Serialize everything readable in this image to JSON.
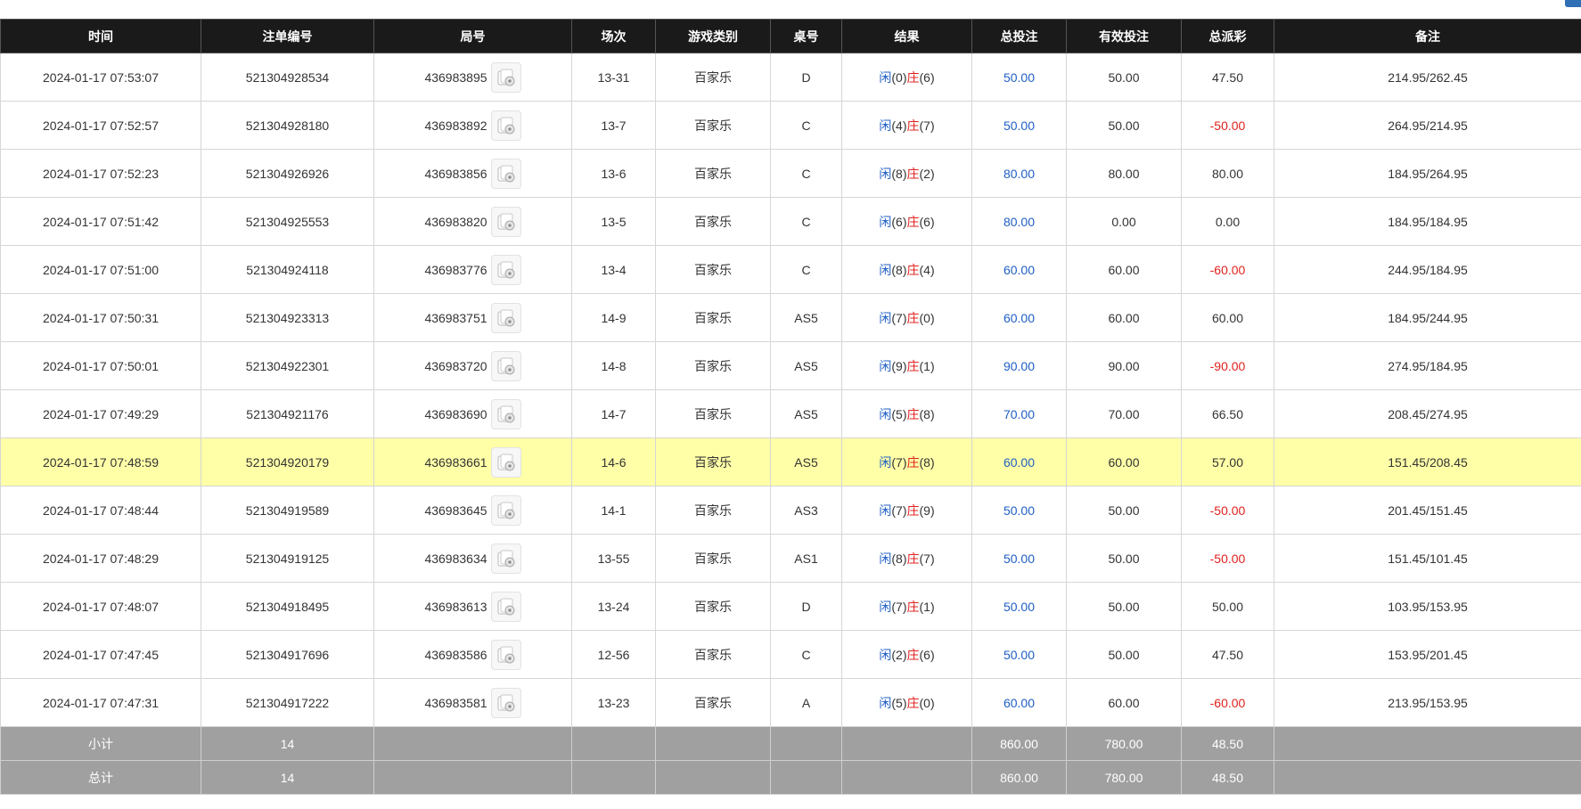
{
  "columns": [
    "时间",
    "注单编号",
    "局号",
    "场次",
    "游戏类别",
    "桌号",
    "结果",
    "总投注",
    "有效投注",
    "总派彩",
    "备注"
  ],
  "result_labels": {
    "player": "闲",
    "banker": "庄"
  },
  "colors": {
    "header_bg": "#1a1a1a",
    "footer_bg": "#a0a0a0",
    "highlight": "#ffffa8",
    "blue": "#1f5fc4",
    "red": "#e0221e"
  },
  "rows": [
    {
      "time": "2024-01-17 07:53:07",
      "bet_id": "521304928534",
      "round": "436983895",
      "session": "13-31",
      "game": "百家乐",
      "table": "D",
      "player_score": "(0)",
      "banker_score": "(6)",
      "total_bet": "50.00",
      "valid_bet": "50.00",
      "payout": "47.50",
      "payout_negative": false,
      "note": "214.95/262.45",
      "highlight": false
    },
    {
      "time": "2024-01-17 07:52:57",
      "bet_id": "521304928180",
      "round": "436983892",
      "session": "13-7",
      "game": "百家乐",
      "table": "C",
      "player_score": "(4)",
      "banker_score": "(7)",
      "total_bet": "50.00",
      "valid_bet": "50.00",
      "payout": "-50.00",
      "payout_negative": true,
      "note": "264.95/214.95",
      "highlight": false
    },
    {
      "time": "2024-01-17 07:52:23",
      "bet_id": "521304926926",
      "round": "436983856",
      "session": "13-6",
      "game": "百家乐",
      "table": "C",
      "player_score": "(8)",
      "banker_score": "(2)",
      "total_bet": "80.00",
      "valid_bet": "80.00",
      "payout": "80.00",
      "payout_negative": false,
      "note": "184.95/264.95",
      "highlight": false
    },
    {
      "time": "2024-01-17 07:51:42",
      "bet_id": "521304925553",
      "round": "436983820",
      "session": "13-5",
      "game": "百家乐",
      "table": "C",
      "player_score": "(6)",
      "banker_score": "(6)",
      "total_bet": "80.00",
      "valid_bet": "0.00",
      "payout": "0.00",
      "payout_negative": false,
      "note": "184.95/184.95",
      "highlight": false
    },
    {
      "time": "2024-01-17 07:51:00",
      "bet_id": "521304924118",
      "round": "436983776",
      "session": "13-4",
      "game": "百家乐",
      "table": "C",
      "player_score": "(8)",
      "banker_score": "(4)",
      "total_bet": "60.00",
      "valid_bet": "60.00",
      "payout": "-60.00",
      "payout_negative": true,
      "note": "244.95/184.95",
      "highlight": false
    },
    {
      "time": "2024-01-17 07:50:31",
      "bet_id": "521304923313",
      "round": "436983751",
      "session": "14-9",
      "game": "百家乐",
      "table": "AS5",
      "player_score": "(7)",
      "banker_score": "(0)",
      "total_bet": "60.00",
      "valid_bet": "60.00",
      "payout": "60.00",
      "payout_negative": false,
      "note": "184.95/244.95",
      "highlight": false
    },
    {
      "time": "2024-01-17 07:50:01",
      "bet_id": "521304922301",
      "round": "436983720",
      "session": "14-8",
      "game": "百家乐",
      "table": "AS5",
      "player_score": "(9)",
      "banker_score": "(1)",
      "total_bet": "90.00",
      "valid_bet": "90.00",
      "payout": "-90.00",
      "payout_negative": true,
      "note": "274.95/184.95",
      "highlight": false
    },
    {
      "time": "2024-01-17 07:49:29",
      "bet_id": "521304921176",
      "round": "436983690",
      "session": "14-7",
      "game": "百家乐",
      "table": "AS5",
      "player_score": "(5)",
      "banker_score": "(8)",
      "total_bet": "70.00",
      "valid_bet": "70.00",
      "payout": "66.50",
      "payout_negative": false,
      "note": "208.45/274.95",
      "highlight": false
    },
    {
      "time": "2024-01-17 07:48:59",
      "bet_id": "521304920179",
      "round": "436983661",
      "session": "14-6",
      "game": "百家乐",
      "table": "AS5",
      "player_score": "(7)",
      "banker_score": "(8)",
      "total_bet": "60.00",
      "valid_bet": "60.00",
      "payout": "57.00",
      "payout_negative": false,
      "note": "151.45/208.45",
      "highlight": true
    },
    {
      "time": "2024-01-17 07:48:44",
      "bet_id": "521304919589",
      "round": "436983645",
      "session": "14-1",
      "game": "百家乐",
      "table": "AS3",
      "player_score": "(7)",
      "banker_score": "(9)",
      "total_bet": "50.00",
      "valid_bet": "50.00",
      "payout": "-50.00",
      "payout_negative": true,
      "note": "201.45/151.45",
      "highlight": false
    },
    {
      "time": "2024-01-17 07:48:29",
      "bet_id": "521304919125",
      "round": "436983634",
      "session": "13-55",
      "game": "百家乐",
      "table": "AS1",
      "player_score": "(8)",
      "banker_score": "(7)",
      "total_bet": "50.00",
      "valid_bet": "50.00",
      "payout": "-50.00",
      "payout_negative": true,
      "note": "151.45/101.45",
      "highlight": false
    },
    {
      "time": "2024-01-17 07:48:07",
      "bet_id": "521304918495",
      "round": "436983613",
      "session": "13-24",
      "game": "百家乐",
      "table": "D",
      "player_score": "(7)",
      "banker_score": "(1)",
      "total_bet": "50.00",
      "valid_bet": "50.00",
      "payout": "50.00",
      "payout_negative": false,
      "note": "103.95/153.95",
      "highlight": false
    },
    {
      "time": "2024-01-17 07:47:45",
      "bet_id": "521304917696",
      "round": "436983586",
      "session": "12-56",
      "game": "百家乐",
      "table": "C",
      "player_score": "(2)",
      "banker_score": "(6)",
      "total_bet": "50.00",
      "valid_bet": "50.00",
      "payout": "47.50",
      "payout_negative": false,
      "note": "153.95/201.45",
      "highlight": false
    },
    {
      "time": "2024-01-17 07:47:31",
      "bet_id": "521304917222",
      "round": "436983581",
      "session": "13-23",
      "game": "百家乐",
      "table": "A",
      "player_score": "(5)",
      "banker_score": "(0)",
      "total_bet": "60.00",
      "valid_bet": "60.00",
      "payout": "-60.00",
      "payout_negative": true,
      "note": "213.95/153.95",
      "highlight": false
    }
  ],
  "subtotal": {
    "label": "小计",
    "count": "14",
    "total_bet": "860.00",
    "valid_bet": "780.00",
    "payout": "48.50"
  },
  "total": {
    "label": "总计",
    "count": "14",
    "total_bet": "860.00",
    "valid_bet": "780.00",
    "payout": "48.50"
  }
}
